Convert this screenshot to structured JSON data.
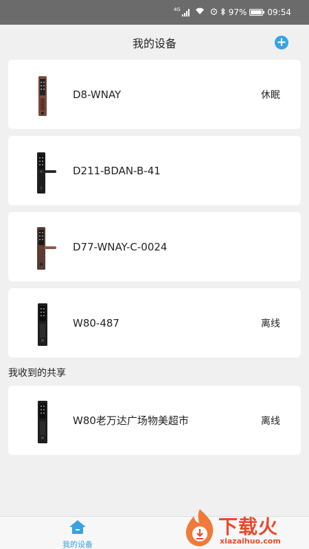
{
  "status_bar": {
    "network": "4G",
    "battery": "97%",
    "battery_level": 0.97,
    "time": "09:54"
  },
  "header": {
    "title": "我的设备",
    "add_icon": "plus-icon",
    "accent_color": "#36a3e6"
  },
  "devices": [
    {
      "name": "D8-WNAY",
      "status": "休眠",
      "lock_color": "#7a4a3a"
    },
    {
      "name": "D211-BDAN-B-41",
      "status": "",
      "lock_color": "#222222"
    },
    {
      "name": "D77-WNAY-C-0024",
      "status": "",
      "lock_color": "#5a3c32"
    },
    {
      "name": "W80-487",
      "status": "离线",
      "lock_color": "#1e1e1e"
    }
  ],
  "shared_section": {
    "title": "我收到的共享",
    "devices": [
      {
        "name": "W80老万达广场物美超市",
        "status": "离线",
        "lock_color": "#1e1e1e"
      }
    ]
  },
  "bottom_nav": {
    "items": [
      {
        "label": "我的设备",
        "icon": "home-icon",
        "active": true
      }
    ]
  },
  "watermark": {
    "text": "下载火",
    "sub": "xiazaihuo.com"
  }
}
